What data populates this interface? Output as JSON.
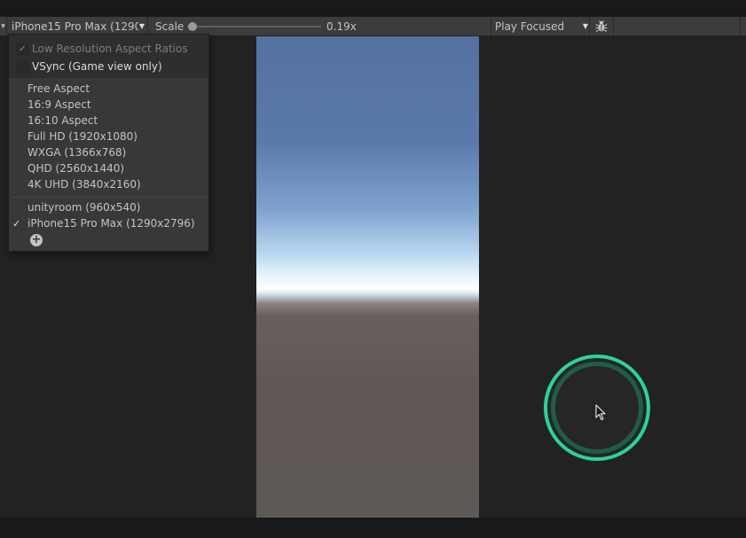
{
  "toolbar": {
    "resolution_label": "iPhone15 Pro Max (1290x2796)",
    "scale_label": "Scale",
    "scale_value": "0.19x",
    "scale_fraction": 0.0,
    "play_focused_label": "Play Focused",
    "bug_icon": "bug-icon"
  },
  "popup": {
    "low_res_label": "Low Resolution Aspect Ratios",
    "low_res_checked": true,
    "vsync_label": "VSync (Game view only)",
    "vsync_checked": false,
    "items": [
      "Free Aspect",
      "16:9 Aspect",
      "16:10 Aspect",
      "Full HD (1920x1080)",
      "WXGA (1366x768)",
      "QHD (2560x1440)",
      "4K UHD (3840x2160)"
    ],
    "custom_items": [
      "unityroom (960x540)",
      "iPhone15 Pro Max (1290x2796)"
    ],
    "selected": "iPhone15 Pro Max (1290x2796)",
    "add_icon": "plus-circle-icon"
  },
  "colors": {
    "touch_ring": "#2ad39a",
    "sky_top": "#5571a0",
    "horizon": "#ffffff",
    "ground": "#5e5955"
  }
}
